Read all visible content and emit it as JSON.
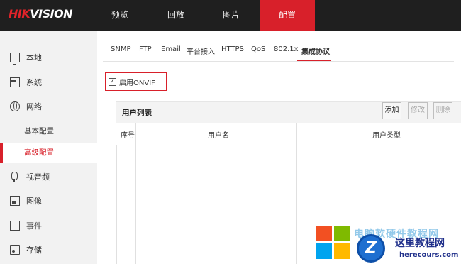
{
  "brand": {
    "hik": "HIK",
    "vision": "VISION"
  },
  "nav": {
    "items": [
      {
        "label": "预览"
      },
      {
        "label": "回放"
      },
      {
        "label": "图片"
      },
      {
        "label": "配置",
        "active": true
      }
    ]
  },
  "sidebar": {
    "items": [
      {
        "label": "本地",
        "icon": "monitor-icon"
      },
      {
        "label": "系统",
        "icon": "system-icon"
      },
      {
        "label": "网络",
        "icon": "globe-icon"
      },
      {
        "label": "基本配置"
      },
      {
        "label": "高级配置",
        "active": true
      },
      {
        "label": "视音频",
        "icon": "microphone-icon"
      },
      {
        "label": "图像",
        "icon": "image-icon"
      },
      {
        "label": "事件",
        "icon": "event-icon"
      },
      {
        "label": "存储",
        "icon": "storage-icon"
      }
    ]
  },
  "tabs": [
    {
      "label": "SNMP"
    },
    {
      "label": "FTP"
    },
    {
      "label": "Email"
    },
    {
      "label": "平台接入"
    },
    {
      "label": "HTTPS"
    },
    {
      "label": "QoS"
    },
    {
      "label": "802.1x"
    },
    {
      "label": "集成协议",
      "active": true
    }
  ],
  "onvif": {
    "checked": true,
    "check_mark": "✓",
    "label": "启用ONVIF"
  },
  "user_list": {
    "title": "用户列表",
    "buttons": {
      "add": "添加",
      "edit": "修改",
      "delete": "删除"
    },
    "columns": [
      "序号",
      "用户名",
      "用户类型"
    ],
    "rows": []
  },
  "watermark": {
    "faded_text": "电脑软硬件教程网",
    "circle_letter": "Z",
    "cn_text": "这里教程网",
    "url": "herecours.com"
  },
  "colors": {
    "accent": "#d8202a",
    "topbar": "#1f1f1f",
    "sidebar": "#f2f2f2"
  }
}
